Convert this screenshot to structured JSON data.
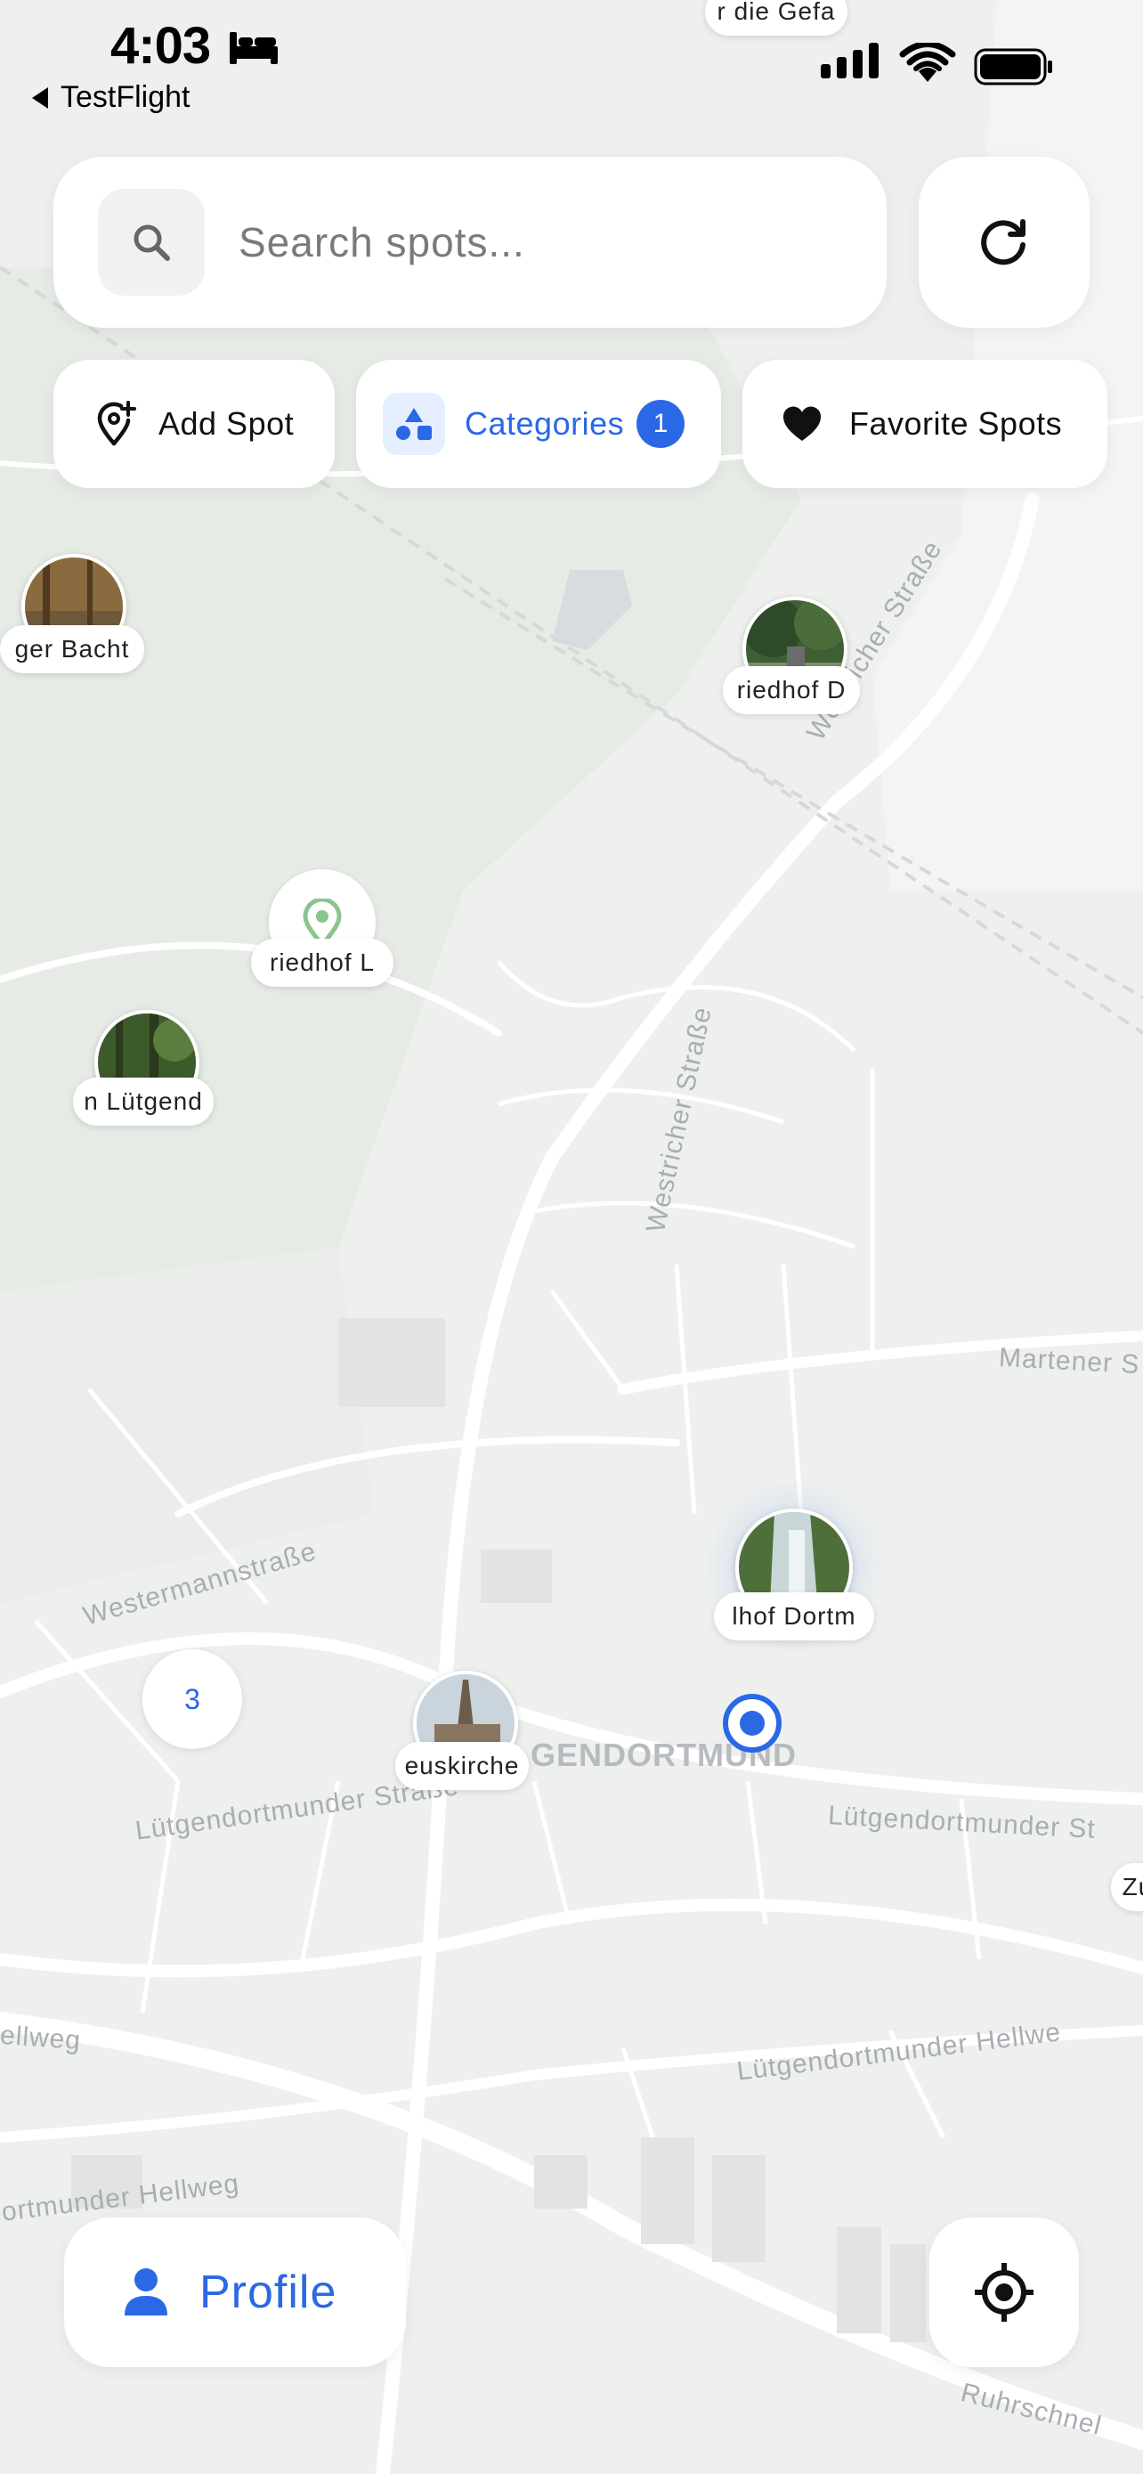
{
  "status_bar": {
    "time": "4:03",
    "back_label": "TestFlight"
  },
  "search": {
    "placeholder": "Search spots..."
  },
  "actions": {
    "add_spot": "Add Spot",
    "categories": "Categories",
    "categories_badge": "1",
    "favorite_spots": "Favorite Spots"
  },
  "pins": [
    {
      "label": "ger Bacht"
    },
    {
      "label": "riedhof D"
    },
    {
      "label": "riedhof L"
    },
    {
      "label": "n Lütgend"
    },
    {
      "label": "lhof Dortm"
    },
    {
      "label": "euskirche"
    },
    {
      "label": "r die Gefa"
    },
    {
      "label": "Zu"
    }
  ],
  "cluster_count": "3",
  "map_labels": {
    "westricher_1": "Westricher Straße",
    "westricher_2": "Westricher Straße",
    "martener": "Martener S",
    "westermann": "Westermannstraße",
    "district": "GENDORTMUND",
    "luetg_str_1": "Lütgendortmunder Straße",
    "luetg_str_2": "Lütgendortmunder St",
    "hellweg_1": "ellweg",
    "hellweg_2": "Lütgendortmunder Hellwe",
    "hellweg_3": "ortmunder Hellweg",
    "ruhrschnell": "Ruhrschnel"
  },
  "profile": {
    "label": "Profile"
  },
  "colors": {
    "accent": "#2a68e6",
    "map_bg": "#eef0ee",
    "green": "#8bc48f"
  }
}
